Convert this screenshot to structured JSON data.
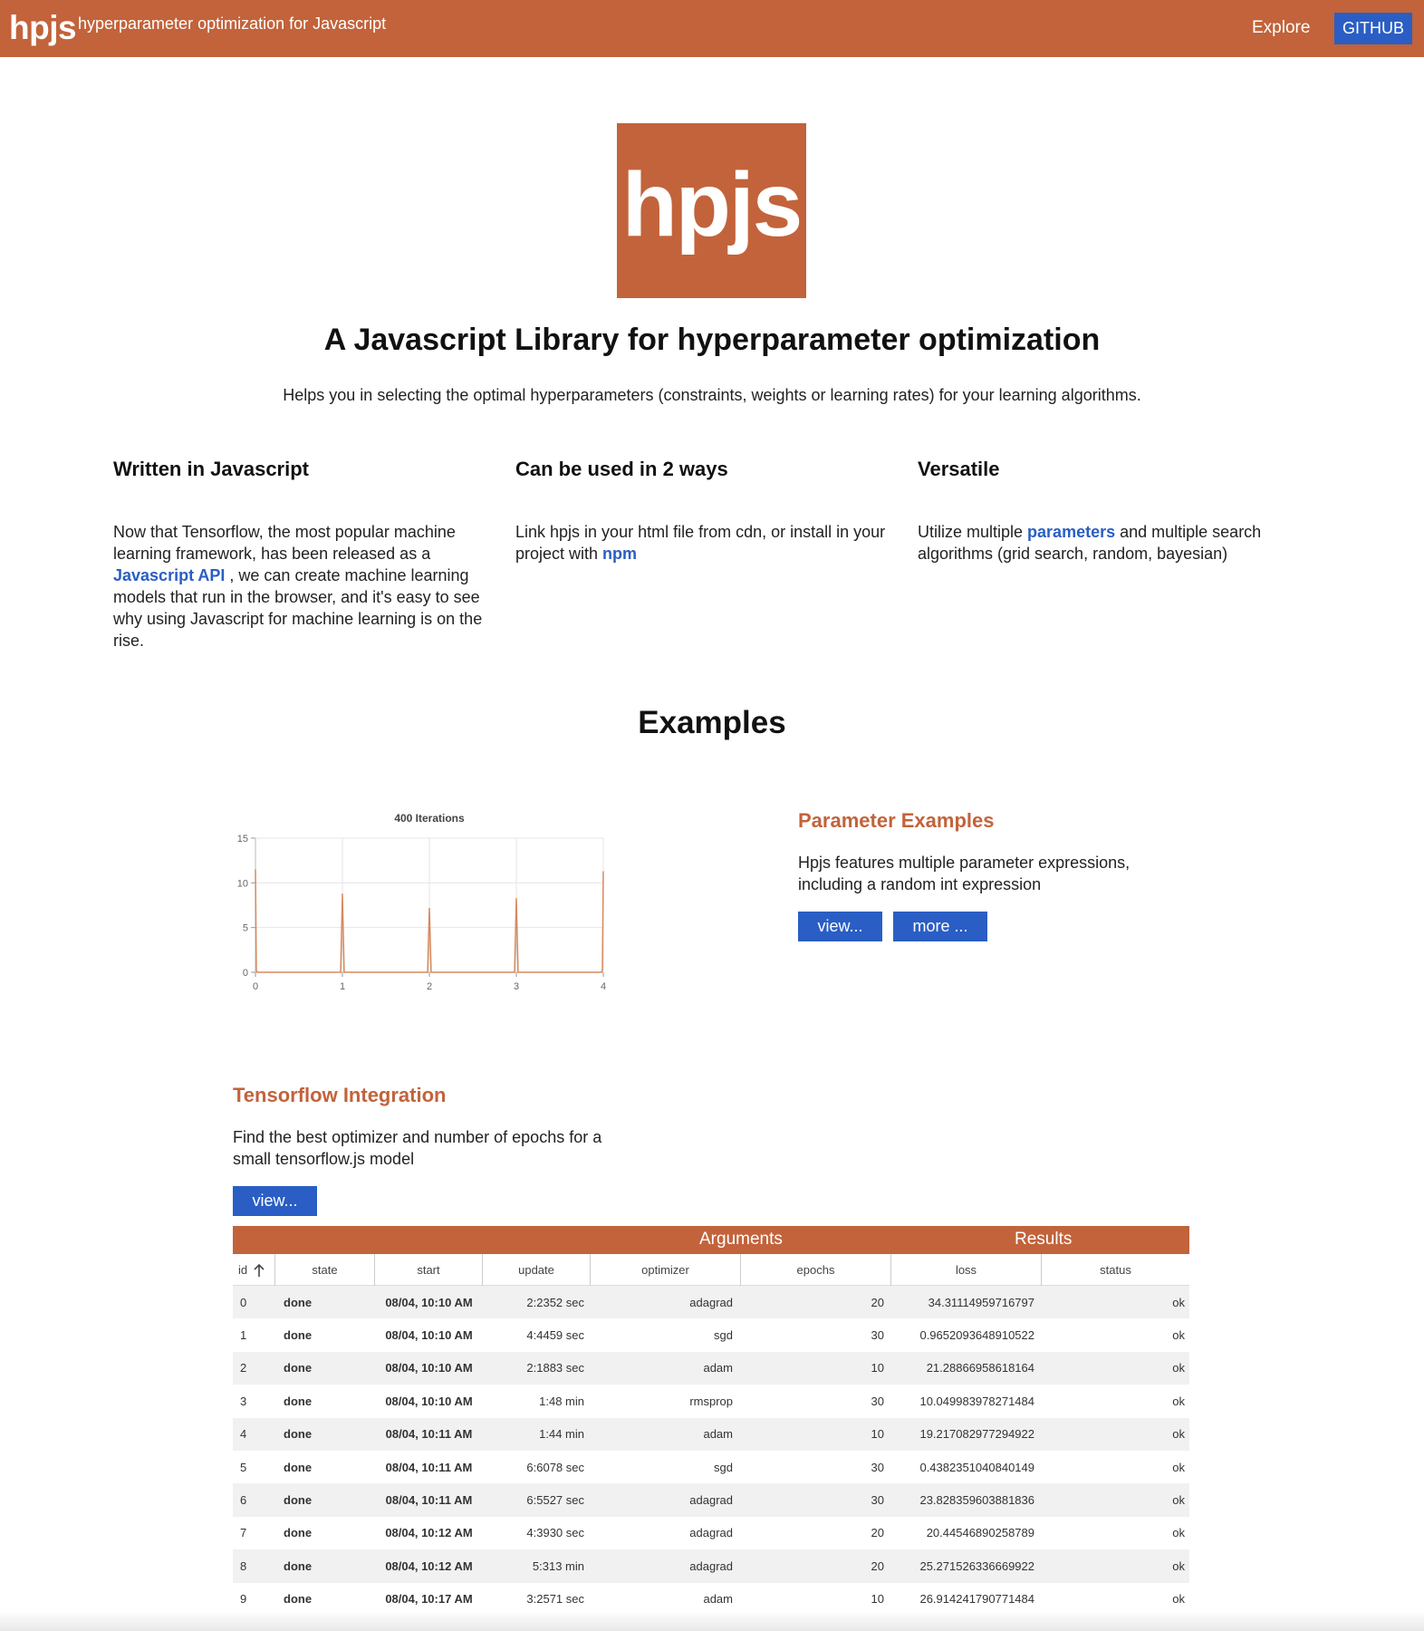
{
  "header": {
    "brand": "hpjs",
    "tagline": "hyperparameter optimization for Javascript",
    "nav_explore": "Explore",
    "nav_github": "GITHUB"
  },
  "hero": {
    "logo_text": "hpjs",
    "title": "A Javascript Library for hyperparameter optimization",
    "subtitle": "Helps you in selecting the optimal hyperparameters (constraints, weights or learning rates) for your learning algorithms."
  },
  "features": [
    {
      "title": "Written in Javascript",
      "text_before": "Now that Tensorflow, the most popular machine learning framework, has been released as a ",
      "link": "Javascript API",
      "text_after": " , we can create machine learning models that run in the browser, and it's easy to see why using Javascript for machine learning is on the rise."
    },
    {
      "title": "Can be used in 2 ways",
      "text_before": "Link hpjs in your html file from cdn, or install in your project with ",
      "link": "npm",
      "text_after": ""
    },
    {
      "title": "Versatile",
      "text_before": "Utilize multiple ",
      "link": "parameters",
      "text_after": " and multiple search algorithms (grid search, random, bayesian)"
    }
  ],
  "examples": {
    "title": "Examples",
    "param": {
      "title": "Parameter Examples",
      "desc": "Hpjs features multiple parameter expressions, including a random int expression",
      "view_button": "view...",
      "more_button": "more ..."
    },
    "tf": {
      "title": "Tensorflow Integration",
      "desc": "Find the best optimizer and number of epochs for a small tensorflow.js model",
      "view_button": "view..."
    }
  },
  "chart_data": {
    "type": "line",
    "title": "400 Iterations",
    "xlabel": "",
    "ylabel": "",
    "xlim": [
      0,
      4
    ],
    "ylim": [
      0,
      15
    ],
    "x_ticks": [
      0,
      1,
      2,
      3,
      4
    ],
    "y_ticks": [
      0,
      5,
      10,
      15
    ],
    "grid": true,
    "color": "#d58a5e",
    "series": [
      {
        "x": [
          0,
          0.01,
          0.02,
          0.98,
          1.0,
          1.02,
          1.98,
          2.0,
          2.02,
          2.98,
          3.0,
          3.02,
          3.98,
          3.99,
          4.0
        ],
        "y": [
          11.5,
          0.2,
          0,
          0,
          8.8,
          0,
          0,
          7.2,
          0,
          0,
          8.3,
          0,
          0,
          0.3,
          11.3
        ]
      }
    ]
  },
  "table": {
    "group_headers": {
      "arguments": "Arguments",
      "results": "Results"
    },
    "columns": [
      "id",
      "state",
      "start",
      "update",
      "optimizer",
      "epochs",
      "loss",
      "status"
    ],
    "sort_icon": "arrow-up-icon",
    "rows": [
      [
        "0",
        "done",
        "08/04, 10:10 AM",
        "2:2352 sec",
        "adagrad",
        "20",
        "34.31114959716797",
        "ok"
      ],
      [
        "1",
        "done",
        "08/04, 10:10 AM",
        "4:4459 sec",
        "sgd",
        "30",
        "0.9652093648910522",
        "ok"
      ],
      [
        "2",
        "done",
        "08/04, 10:10 AM",
        "2:1883 sec",
        "adam",
        "10",
        "21.28866958618164",
        "ok"
      ],
      [
        "3",
        "done",
        "08/04, 10:10 AM",
        "1:48 min",
        "rmsprop",
        "30",
        "10.049983978271484",
        "ok"
      ],
      [
        "4",
        "done",
        "08/04, 10:11 AM",
        "1:44 min",
        "adam",
        "10",
        "19.217082977294922",
        "ok"
      ],
      [
        "5",
        "done",
        "08/04, 10:11 AM",
        "6:6078 sec",
        "sgd",
        "30",
        "0.4382351040840149",
        "ok"
      ],
      [
        "6",
        "done",
        "08/04, 10:11 AM",
        "6:5527 sec",
        "adagrad",
        "30",
        "23.828359603881836",
        "ok"
      ],
      [
        "7",
        "done",
        "08/04, 10:12 AM",
        "4:3930 sec",
        "adagrad",
        "20",
        "20.44546890258789",
        "ok"
      ],
      [
        "8",
        "done",
        "08/04, 10:12 AM",
        "5:313 min",
        "adagrad",
        "20",
        "25.271526336669922",
        "ok"
      ],
      [
        "9",
        "done",
        "08/04, 10:17 AM",
        "3:2571 sec",
        "adam",
        "10",
        "26.914241790771484",
        "ok"
      ]
    ]
  }
}
